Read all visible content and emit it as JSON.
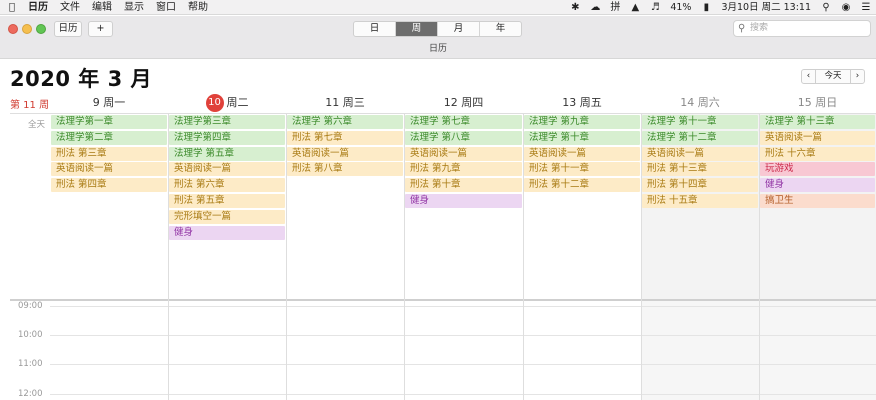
{
  "menubar": {
    "app": "日历",
    "items": [
      "文件",
      "编辑",
      "显示",
      "窗口",
      "帮助"
    ],
    "battery": "41%",
    "datetime": "3月10日 周二 13:11",
    "input_method": "拼"
  },
  "toolbar": {
    "calendars_label": "日历",
    "add_label": "+",
    "views": [
      "日",
      "周",
      "月",
      "年"
    ],
    "active_view": "周",
    "search_placeholder": "搜索"
  },
  "window_title": "日历",
  "header": {
    "month_title": "2020 年 3 月",
    "week_number": "第 11 周",
    "today_label": "今天",
    "prev": "‹",
    "next": "›"
  },
  "allday_label": "全天",
  "days": [
    {
      "label": "9 周一",
      "weekend": false
    },
    {
      "num": "10",
      "label": "周二",
      "weekend": false,
      "today": true
    },
    {
      "label": "11 周三",
      "weekend": false
    },
    {
      "label": "12 周四",
      "weekend": false
    },
    {
      "label": "13 周五",
      "weekend": false
    },
    {
      "label": "14 周六",
      "weekend": true
    },
    {
      "label": "15 周日",
      "weekend": true
    }
  ],
  "events": [
    [
      {
        "title": "法理学第一章",
        "color": "green"
      },
      {
        "title": "法理学第二章",
        "color": "green"
      },
      {
        "title": "刑法 第三章",
        "color": "yellow"
      },
      {
        "title": "英语阅读一篇",
        "color": "yellow"
      },
      {
        "title": "刑法 第四章",
        "color": "yellow"
      }
    ],
    [
      {
        "title": "法理学第三章",
        "color": "green"
      },
      {
        "title": "法理学第四章",
        "color": "green"
      },
      {
        "title": "法理学 第五章",
        "color": "green"
      },
      {
        "title": "英语阅读一篇",
        "color": "yellow"
      },
      {
        "title": "刑法 第六章",
        "color": "yellow"
      },
      {
        "title": "刑法 第五章",
        "color": "yellow"
      },
      {
        "title": "完形填空一篇",
        "color": "yellow"
      },
      {
        "title": "健身",
        "color": "purple"
      }
    ],
    [
      {
        "title": "法理学 第六章",
        "color": "green"
      },
      {
        "title": "刑法 第七章",
        "color": "yellow"
      },
      {
        "title": "英语阅读一篇",
        "color": "yellow"
      },
      {
        "title": "刑法 第八章",
        "color": "yellow"
      }
    ],
    [
      {
        "title": "法理学 第七章",
        "color": "green"
      },
      {
        "title": "法理学 第八章",
        "color": "green"
      },
      {
        "title": "英语阅读一篇",
        "color": "yellow"
      },
      {
        "title": "刑法 第九章",
        "color": "yellow"
      },
      {
        "title": "刑法 第十章",
        "color": "yellow"
      },
      {
        "title": "健身",
        "color": "purple"
      }
    ],
    [
      {
        "title": "法理学 第九章",
        "color": "green"
      },
      {
        "title": "法理学 第十章",
        "color": "green"
      },
      {
        "title": "英语阅读一篇",
        "color": "yellow"
      },
      {
        "title": "刑法 第十一章",
        "color": "yellow"
      },
      {
        "title": "刑法 第十二章",
        "color": "yellow"
      }
    ],
    [
      {
        "title": "法理学 第十一章",
        "color": "green"
      },
      {
        "title": "法理学 第十二章",
        "color": "green"
      },
      {
        "title": "英语阅读一篇",
        "color": "yellow"
      },
      {
        "title": "刑法 第十三章",
        "color": "yellow"
      },
      {
        "title": "刑法 第十四章",
        "color": "yellow"
      },
      {
        "title": "刑法 十五章",
        "color": "yellow"
      }
    ],
    [
      {
        "title": "法理学 第十三章",
        "color": "green"
      },
      {
        "title": "英语阅读一篇",
        "color": "yellow"
      },
      {
        "title": "刑法 十六章",
        "color": "yellow"
      },
      {
        "title": "玩游戏",
        "color": "pink"
      },
      {
        "title": "健身",
        "color": "purple"
      },
      {
        "title": "搞卫生",
        "color": "salmon"
      }
    ]
  ],
  "time_labels": [
    "09:00",
    "10:00",
    "11:00",
    "12:00"
  ]
}
